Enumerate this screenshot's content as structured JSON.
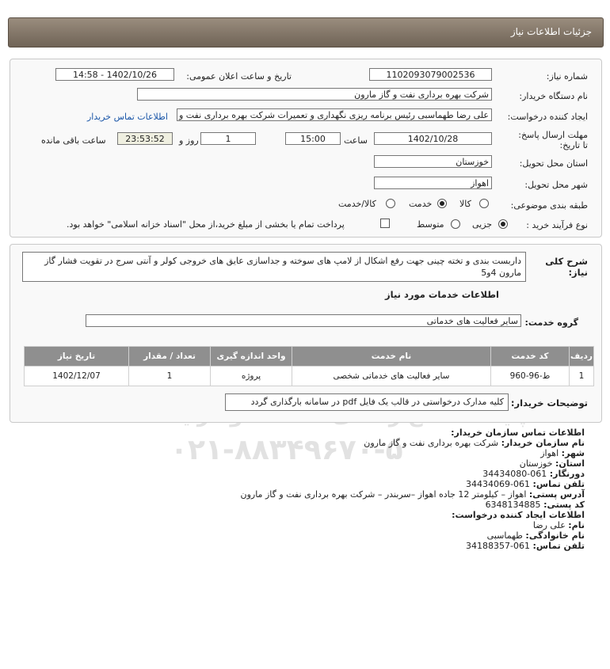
{
  "header": {
    "title": "جزئیات اطلاعات نیاز"
  },
  "form": {
    "need_number_label": "شماره نیاز:",
    "need_number": "1102093079002536",
    "announce_label": "تاریخ و ساعت اعلان عمومی:",
    "announce_value": "1402/10/26 - 14:58",
    "buyer_org_label": "نام دستگاه خریدار:",
    "buyer_org": "شرکت بهره برداری نفت و گاز مارون",
    "creator_label": "ایجاد کننده درخواست:",
    "creator": "علی رضا طهماسبی رئیس برنامه ریزی نگهداری و تعمیرات شرکت بهره برداری نفت و گاز مارون",
    "buyer_contact_link": "اطلاعات تماس خریدار",
    "deadline_label": "مهلت ارسال پاسخ: تا تاریخ:",
    "deadline_date": "1402/10/28",
    "time_label": "ساعت",
    "deadline_time": "15:00",
    "days_value": "1",
    "days_label": "روز و",
    "remaining_value": "23:53:52",
    "remaining_label": "ساعت باقی مانده",
    "province_label": "استان محل تحویل:",
    "province": "خوزستان",
    "city_label": "شهر محل تحویل:",
    "city": "اهواز",
    "category_label": "طبقه بندی موضوعی:",
    "category_options": [
      "کالا",
      "خدمت",
      "کالا/خدمت"
    ],
    "category_selected": "خدمت",
    "process_label": "نوع فرآیند خرید :",
    "process_options": [
      "جزیی",
      "متوسط"
    ],
    "process_selected": "جزیی",
    "treasury_text": "پرداخت تمام یا بخشی از مبلغ خرید،از محل \"اسناد خزانه اسلامی\" خواهد بود."
  },
  "need": {
    "summary_label": "شرح کلی نیاز:",
    "summary": "داربست بندی و تخته چینی جهت رفع اشکال از لامپ های سوخته و جداسازی عایق های خروجی کولر و آنتی سرج در تقویت فشار گاز مارون 4و5",
    "services_title": "اطلاعات خدمات مورد نیاز",
    "service_group_label": "گروه خدمت:",
    "service_group": "سایر فعالیت های خدماتی",
    "table": {
      "headers": [
        "ردیف",
        "کد خدمت",
        "نام خدمت",
        "واحد اندازه گیری",
        "تعداد / مقدار",
        "تاریخ نیاز"
      ],
      "rows": [
        [
          "1",
          "ط-96-960",
          "سایر فعالیت های خدماتی شخصی",
          "پروژه",
          "1",
          "1402/12/07"
        ]
      ]
    },
    "buyer_notes_label": "توضیحات خریدار:",
    "buyer_notes": "کلیه مدارک درخواستی در قالب یک فایل pdf در سامانه بارگذاری گردد"
  },
  "contact": {
    "org_section": "اطلاعات تماس سازمان خریدار:",
    "org_name_label": "نام سازمان خریدار:",
    "org_name": "شرکت بهره برداری نفت و گاز مارون",
    "city_label": "شهر:",
    "city": "اهواز",
    "province_label": "استان:",
    "province": "خوزستان",
    "fax_label": "دورنگار:",
    "fax": "061-34434080",
    "phone_label": "تلفن تماس:",
    "phone": "061-34434069",
    "address_label": "آدرس پستی:",
    "address": "اهواز – کیلومتر 12 جاده اهواز –سربندر – شرکت بهره برداری نفت و گاز مارون",
    "postal_label": "کد پستی:",
    "postal": "6348134885",
    "creator_section": "اطلاعات ایجاد کننده درخواست:",
    "first_name_label": "نام:",
    "first_name": "علی رضا",
    "last_name_label": "نام خانوادگی:",
    "last_name": "طهماسبی",
    "creator_phone_label": "تلفن تماس:",
    "creator_phone": "061-34188357"
  },
  "watermark": {
    "brand": "ParsNamadData",
    "tagline": "پایگاه اطلاع رسانی مناقصه و مزایده",
    "phone": "۰۲۱-۸۸۳۴۹۶۷۰-۵"
  },
  "colors": {
    "header_bg": "#7f7366",
    "link": "#1a56a8",
    "table_header": "#8f8f8f"
  }
}
